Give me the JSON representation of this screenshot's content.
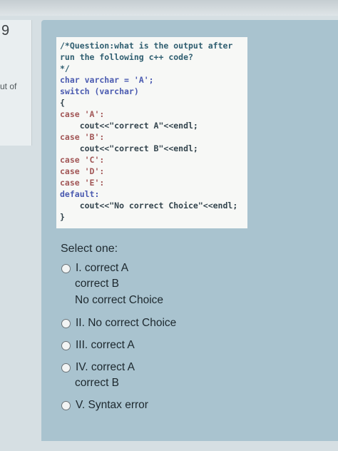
{
  "sidebar": {
    "question_number": "9",
    "out_of_label": "ut of"
  },
  "code": {
    "lines": [
      "/*Question:what is the output after",
      "run the following c++ code?",
      "*/",
      "char varchar = 'A';",
      "switch (varchar)",
      "{",
      "case 'A':",
      "    cout<<\"correct A\"<<endl;",
      "case 'B':",
      "    cout<<\"correct B\"<<endl;",
      "case 'C':",
      "case 'D':",
      "case 'E':",
      "default:",
      "    cout<<\"No correct Choice\"<<endl;",
      "}"
    ]
  },
  "answer": {
    "prompt": "Select one:",
    "options": [
      {
        "lines": [
          "I. correct A",
          "correct B",
          "No correct Choice"
        ],
        "selected": false
      },
      {
        "lines": [
          "II. No correct Choice"
        ],
        "selected": false
      },
      {
        "lines": [
          "III. correct A"
        ],
        "selected": false
      },
      {
        "lines": [
          "IV. correct A",
          "correct B"
        ],
        "selected": false
      },
      {
        "lines": [
          "V. Syntax error"
        ],
        "selected": false
      }
    ]
  }
}
